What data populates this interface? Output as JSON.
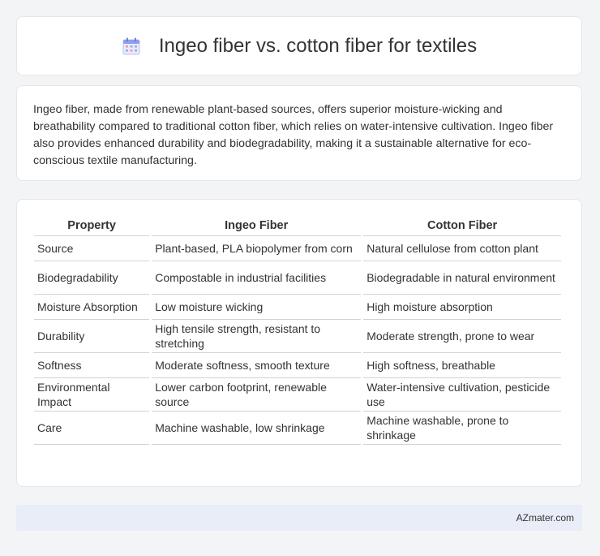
{
  "header": {
    "icon": "calendar-icon",
    "title": "Ingeo fiber vs. cotton fiber for textiles"
  },
  "intro": {
    "text": "Ingeo fiber, made from renewable plant-based sources, offers superior moisture-wicking and breathability compared to traditional cotton fiber, which relies on water-intensive cultivation. Ingeo fiber also provides enhanced durability and biodegradability, making it a sustainable alternative for eco-conscious textile manufacturing."
  },
  "table": {
    "headers": [
      "Property",
      "Ingeo Fiber",
      "Cotton Fiber"
    ],
    "rows": [
      [
        "Source",
        "Plant-based, PLA biopolymer from corn",
        "Natural cellulose from cotton plant"
      ],
      [
        "Biodegradability",
        "Compostable in industrial facilities",
        "Biodegradable in natural environment"
      ],
      [
        "Moisture Absorption",
        "Low moisture wicking",
        "High moisture absorption"
      ],
      [
        "Durability",
        "High tensile strength, resistant to stretching",
        "Moderate strength, prone to wear"
      ],
      [
        "Softness",
        "Moderate softness, smooth texture",
        "High softness, breathable"
      ],
      [
        "Environmental Impact",
        "Lower carbon footprint, renewable source",
        "Water-intensive cultivation, pesticide use"
      ],
      [
        "Care",
        "Machine washable, low shrinkage",
        "Machine washable, prone to shrinkage"
      ]
    ]
  },
  "footer": {
    "brand": "AZmater.com"
  },
  "colors": {
    "page_bg": "#f3f4f6",
    "card_bg": "#ffffff",
    "footer_bg": "#e9edf7",
    "text": "#333333",
    "icon_accent": "#7b8cde"
  }
}
